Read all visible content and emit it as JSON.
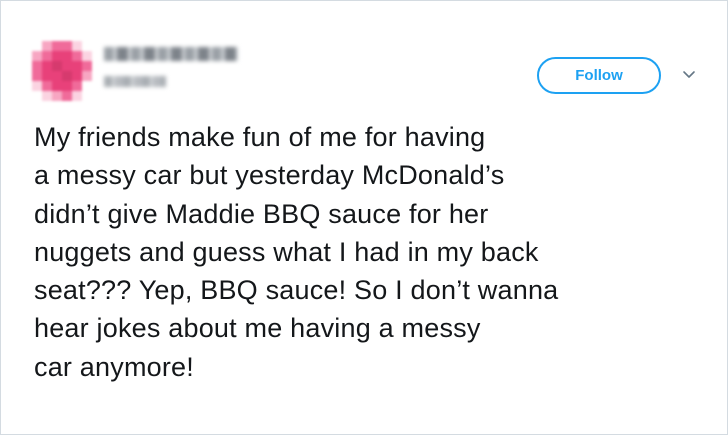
{
  "header": {
    "follow_label": "Follow",
    "menu_icon": "chevron-down-icon",
    "avatar_icon": "blurred-avatar"
  },
  "tweet": {
    "lines": [
      "My friends make fun of me for having",
      "a messy car but yesterday McDonald’s",
      "didn’t give Maddie BBQ sauce for her",
      "nuggets and guess what I had in my back",
      "seat??? Yep, BBQ sauce! So I don’t wanna",
      "hear jokes about me having a messy",
      "car anymore!"
    ]
  },
  "colors": {
    "accent": "#1da1f2",
    "text": "#14171a",
    "border": "#d4dbe1",
    "avatar_palette": [
      "#e8417a",
      "#f06b9a",
      "#d63a6e",
      "#f7a6c2",
      "#ffffff",
      "#fbd3e1"
    ]
  }
}
